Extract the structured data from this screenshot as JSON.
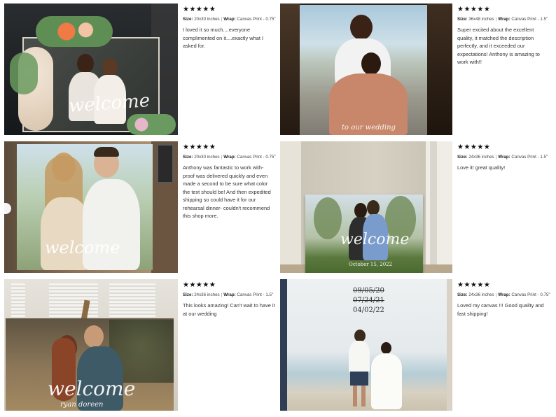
{
  "reviews": [
    {
      "stars": "★★★★★",
      "size_label": "Size:",
      "size_value": "20x30 inches",
      "wrap_label": "Wrap:",
      "wrap_value": "Canvas Print - 0.75\"",
      "text": "I loved it so much....everyone complimented on it....exactly what I asked for.",
      "photo": {
        "script": "welcome",
        "sub": ""
      }
    },
    {
      "stars": "★★★★★",
      "size_label": "Size:",
      "size_value": "36x48 inches",
      "wrap_label": "Wrap:",
      "wrap_value": "Canvas Print - 1.5\"",
      "text": "Super excited about the excellent quality, it matched the description perfectly, and it exceeded our expectations! Anthony is amazing to work with!!",
      "photo": {
        "script": "",
        "sub": "to our wedding"
      }
    },
    {
      "stars": "★★★★★",
      "size_label": "Size:",
      "size_value": "20x30 inches",
      "wrap_label": "Wrap:",
      "wrap_value": "Canvas Print - 0.75\"",
      "text": "Anthony was fantastic to work with- proof was delivered quickly and even made a second to be sure what color the text should be! And then expedited shipping so could have it for our rehearsal dinner- couldn't recommend this shop more.",
      "photo": {
        "script": "welcome",
        "sub": ""
      }
    },
    {
      "stars": "★★★★★",
      "size_label": "Size:",
      "size_value": "24x36 inches",
      "wrap_label": "Wrap:",
      "wrap_value": "Canvas Print - 1.5\"",
      "text": "Love it! great quality!",
      "photo": {
        "script": "welcome",
        "sub": "October 15, 2022"
      }
    },
    {
      "stars": "★★★★★",
      "size_label": "Size:",
      "size_value": "24x36 inches",
      "wrap_label": "Wrap:",
      "wrap_value": "Canvas Print - 1.5\"",
      "text": "This looks amazing! Can't wait to have it at our wedding",
      "photo": {
        "script": "welcome",
        "sub": "ryan   doreen"
      }
    },
    {
      "stars": "★★★★★",
      "size_label": "Size:",
      "size_value": "24x36 inches",
      "wrap_label": "Wrap:",
      "wrap_value": "Canvas Print - 0.75\"",
      "text": "Loved my canvas !!! Good quality and fast shipping!",
      "photo": {
        "script": "",
        "sub": "",
        "dates_struck": [
          "09/05/20",
          "07/24/21"
        ],
        "date_final": "04/02/22"
      }
    }
  ]
}
